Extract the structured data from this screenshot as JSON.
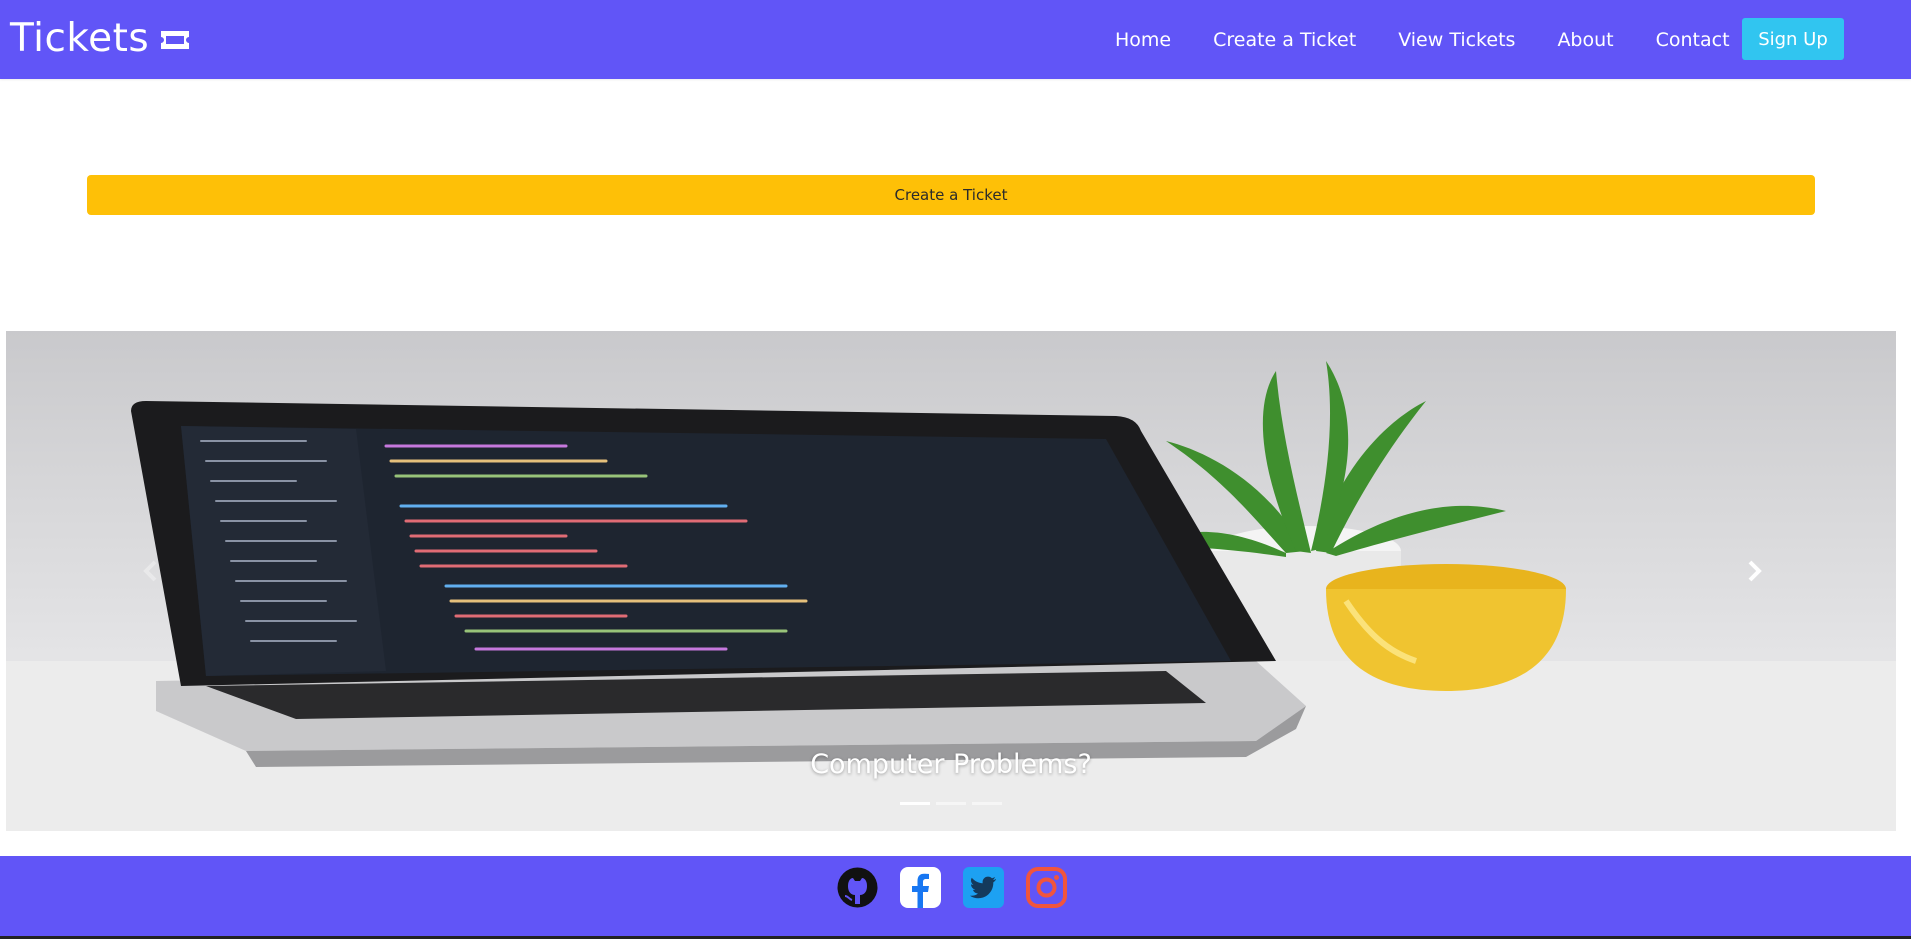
{
  "header": {
    "brand": "Tickets",
    "brand_icon": "ticket-icon",
    "nav": [
      {
        "label": "Home"
      },
      {
        "label": "Create a Ticket"
      },
      {
        "label": "View Tickets"
      },
      {
        "label": "About"
      },
      {
        "label": "Contact"
      }
    ],
    "signup_label": "Sign Up"
  },
  "main": {
    "create_button_label": "Create a Ticket"
  },
  "carousel": {
    "slide_caption": "Computer Problems?",
    "slide_count": 3,
    "active_slide": 1
  },
  "footer": {
    "social": [
      "github-icon",
      "facebook-icon",
      "twitter-icon",
      "instagram-icon"
    ]
  },
  "colors": {
    "brand": "#6155f7",
    "accent": "#31c5f0",
    "warning": "#fec007"
  }
}
